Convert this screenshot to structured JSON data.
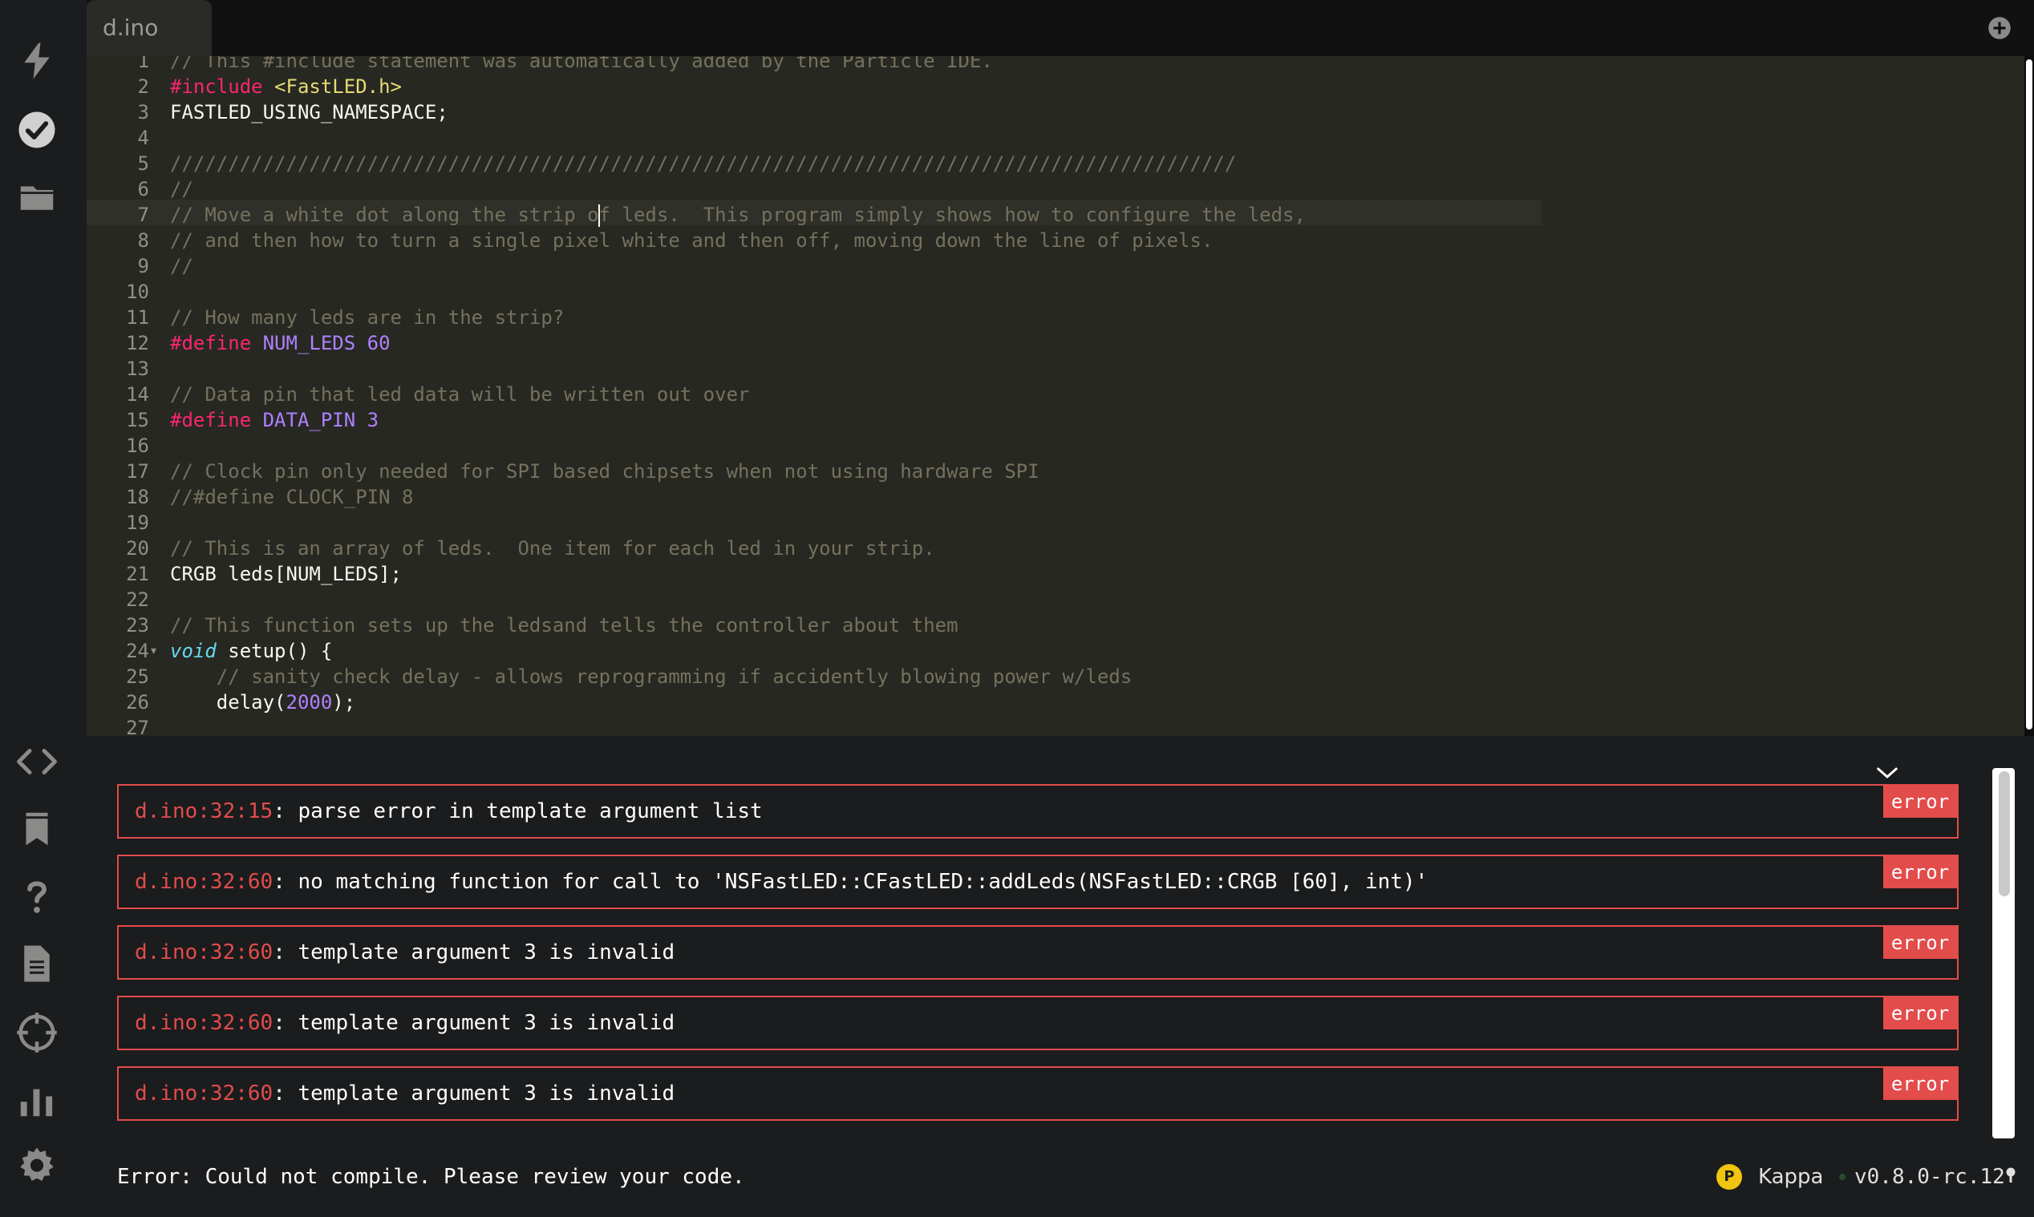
{
  "tab": {
    "filename": "d.ino"
  },
  "colors": {
    "error_red": "#e24c4b",
    "editor_bg": "#272822",
    "comment": "#75715e",
    "keyword": "#f92672",
    "string": "#e6db74",
    "number": "#ae81ff",
    "type": "#66d9ef",
    "device_badge": "#f1c40f"
  },
  "sidebar": {
    "top_icons": [
      "flash-icon",
      "verify-icon",
      "folder-icon"
    ],
    "bottom_icons": [
      "code-icon",
      "libraries-icon",
      "help-icon",
      "docs-icon",
      "devices-icon",
      "console-icon",
      "settings-icon"
    ]
  },
  "editor": {
    "line_numbers": [
      "1",
      "2",
      "3",
      "4",
      "5",
      "6",
      "7",
      "8",
      "9",
      "10",
      "11",
      "12",
      "13",
      "14",
      "15",
      "16",
      "17",
      "18",
      "19",
      "20",
      "21",
      "22",
      "23",
      "24",
      "25",
      "26",
      "27"
    ],
    "lines": {
      "l1": "// This #include statement was automatically added by the Particle IDE.",
      "l2_directive": "#include",
      "l2_header": "<FastLED.h>",
      "l3": "FASTLED_USING_NAMESPACE;",
      "l5": "////////////////////////////////////////////////////////////////////////////////////////////",
      "l6": "//",
      "l7_before": "// Move a white dot along the strip o",
      "l7_after": "f leds.  This program simply shows how to configure the leds,",
      "l8": "// and then how to turn a single pixel white and then off, moving down the line of pixels.",
      "l9": "//",
      "l11": "// How many leds are in the strip?",
      "l12_directive": "#define",
      "l12_name": "NUM_LEDS",
      "l12_value": "60",
      "l14": "// Data pin that led data will be written out over",
      "l15_directive": "#define",
      "l15_name": "DATA_PIN",
      "l15_value": "3",
      "l17": "// Clock pin only needed for SPI based chipsets when not using hardware SPI",
      "l18": "//#define CLOCK_PIN 8",
      "l20": "// This is an array of leds.  One item for each led in your strip.",
      "l21": "CRGB leds[NUM_LEDS];",
      "l23": "// This function sets up the ledsand tells the controller about them",
      "l24_type": "void",
      "l24_rest": " setup() {",
      "l25": "    // sanity check delay - allows reprogramming if accidently blowing power w/leds",
      "l26_before": "    delay(",
      "l26_value": "2000",
      "l26_after": ");"
    }
  },
  "errors": [
    {
      "location": "d.ino:32:15",
      "message": ": parse error in template argument list",
      "badge": "error"
    },
    {
      "location": "d.ino:32:60",
      "message": ": no matching function for call to 'NSFastLED::CFastLED::addLeds(NSFastLED::CRGB [60], int)'",
      "badge": "error"
    },
    {
      "location": "d.ino:32:60",
      "message": ": template argument 3 is invalid",
      "badge": "error"
    },
    {
      "location": "d.ino:32:60",
      "message": ": template argument 3 is invalid",
      "badge": "error"
    },
    {
      "location": "d.ino:32:60",
      "message": ": template argument 3 is invalid",
      "badge": "error"
    }
  ],
  "status": {
    "message": "Error: Could not compile. Please review your code.",
    "device_initial": "P",
    "device_name": "Kappa",
    "firmware_version": "v0.8.0-rc.12"
  }
}
